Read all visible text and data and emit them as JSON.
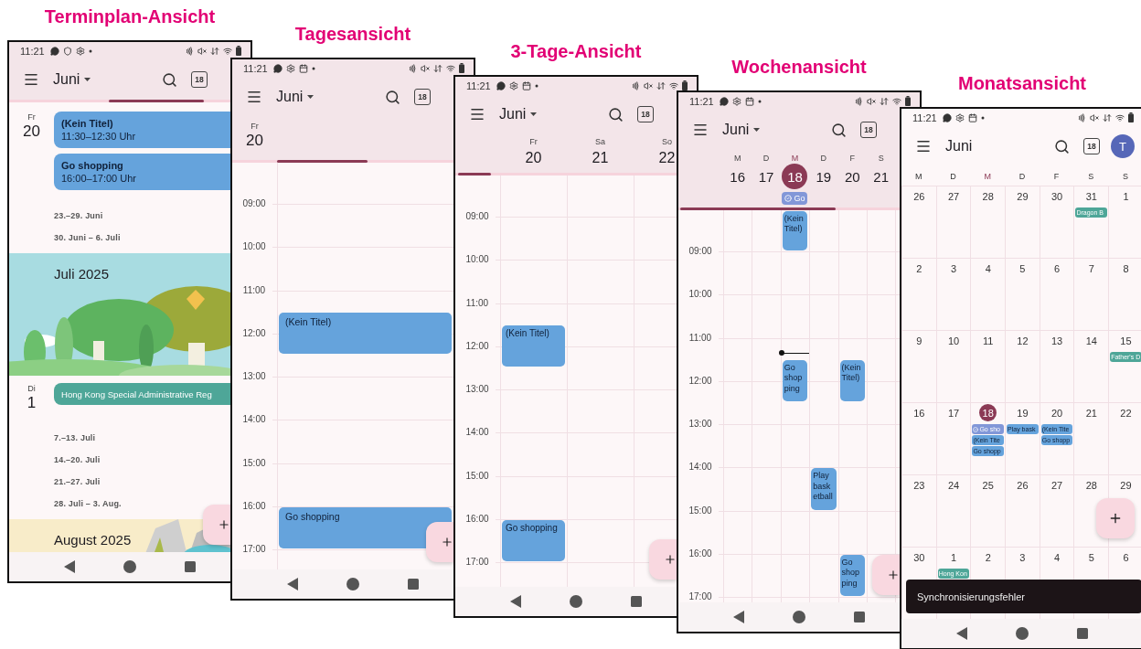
{
  "screens": [
    {
      "kind": "schedule",
      "caption": "Terminplan-Ansicht",
      "time": "11:21",
      "month": "Juni",
      "dropdown": true,
      "today": "18",
      "agenda": [
        {
          "kind": "day",
          "weekday": "Fr",
          "day": "20",
          "events": [
            {
              "title": "(Kein Titel)",
              "time": "11:30–12:30 Uhr",
              "kind": "event",
              "color": "#65a3dc"
            },
            {
              "title": "Go shopping",
              "time": "16:00–17:00 Uhr",
              "kind": "event",
              "color": "#65a3dc"
            }
          ]
        },
        {
          "kind": "range",
          "text": "23.–29. Juni"
        },
        {
          "kind": "range",
          "text": "30. Juni – 6. Juli"
        },
        {
          "kind": "month",
          "title": "Juli 2025"
        },
        {
          "kind": "day",
          "weekday": "Di",
          "day": "1",
          "events": [
            {
              "title": "Hong Kong Special Administrative Reg",
              "kind": "holiday",
              "color": "#4ea698"
            }
          ]
        },
        {
          "kind": "range",
          "text": "7.–13. Juli"
        },
        {
          "kind": "range",
          "text": "14.–20. Juli"
        },
        {
          "kind": "range",
          "text": "21.–27. Juli"
        },
        {
          "kind": "range",
          "text": "28. Juli – 3. Aug."
        },
        {
          "kind": "month",
          "title": "August 2025"
        }
      ]
    },
    {
      "kind": "day",
      "caption": "Tagesansicht",
      "time": "11:21",
      "month": "Juni",
      "dropdown": true,
      "today": "18",
      "days": [
        {
          "weekday": "Fr",
          "day": "20",
          "events": [
            {
              "title": "(Kein Titel)",
              "kind": "event",
              "color": "#65a3dc"
            },
            {
              "title": "Go shopping",
              "kind": "event",
              "color": "#65a3dc"
            }
          ]
        }
      ],
      "hours": [
        "09:00",
        "10:00",
        "11:00",
        "12:00",
        "13:00",
        "14:00",
        "15:00",
        "16:00",
        "17:00"
      ]
    },
    {
      "kind": "three",
      "caption": "3-Tage-Ansicht",
      "time": "11:21",
      "month": "Juni",
      "dropdown": true,
      "today": "18",
      "days": [
        {
          "weekday": "Fr",
          "day": "20",
          "events": [
            {
              "title": "(Kein Titel)",
              "kind": "event",
              "color": "#65a3dc"
            },
            {
              "title": "Go shopping",
              "kind": "event",
              "color": "#65a3dc"
            }
          ]
        },
        {
          "weekday": "Sa",
          "day": "21"
        },
        {
          "weekday": "So",
          "day": "22"
        }
      ],
      "hours": [
        "09:00",
        "10:00",
        "11:00",
        "12:00",
        "13:00",
        "14:00",
        "15:00",
        "16:00",
        "17:00"
      ]
    },
    {
      "kind": "week",
      "caption": "Wochenansicht",
      "time": "11:21",
      "month": "Juni",
      "dropdown": true,
      "today": "18",
      "days": [
        {
          "weekday": "M",
          "day": "16",
          "today": false,
          "now": false
        },
        {
          "weekday": "D",
          "day": "17",
          "today": false,
          "now": false
        },
        {
          "weekday": "M",
          "day": "18",
          "today": true,
          "now": true,
          "all_day": [
            {
              "title": "Go",
              "kind": "task",
              "color": "#8297d8"
            }
          ],
          "events": [
            {
              "title": "(Kein Titel)",
              "kind": "event",
              "color": "#65a3dc"
            },
            {
              "title": "Go shopping",
              "kind": "event",
              "color": "#65a3dc"
            }
          ]
        },
        {
          "weekday": "D",
          "day": "19",
          "today": false,
          "now": false,
          "events": [
            {
              "title": "Play basketball",
              "kind": "event",
              "color": "#65a3dc"
            }
          ]
        },
        {
          "weekday": "F",
          "day": "20",
          "today": false,
          "now": false,
          "events": [
            {
              "title": "(Kein Titel)",
              "kind": "event",
              "color": "#65a3dc"
            },
            {
              "title": "Go shopping",
              "kind": "event",
              "color": "#65a3dc"
            }
          ]
        },
        {
          "weekday": "S",
          "day": "21",
          "today": false,
          "now": false
        }
      ],
      "hours": [
        "09:00",
        "10:00",
        "11:00",
        "12:00",
        "13:00",
        "14:00",
        "15:00",
        "16:00",
        "17:00"
      ]
    },
    {
      "kind": "month",
      "caption": "Monatsansicht",
      "time": "11:21",
      "month": "Juni",
      "dropdown": false,
      "today": "18",
      "avatar": "T",
      "weekdays": [
        {
          "label": "M",
          "today": false
        },
        {
          "label": "D",
          "today": false
        },
        {
          "label": "M",
          "today": true
        },
        {
          "label": "D",
          "today": false
        },
        {
          "label": "F",
          "today": false
        },
        {
          "label": "S",
          "today": false
        },
        {
          "label": "S",
          "today": false
        }
      ],
      "weeks": [
        [
          {
            "day": "26",
            "today": false
          },
          {
            "day": "27",
            "today": false
          },
          {
            "day": "28",
            "today": false
          },
          {
            "day": "29",
            "today": false
          },
          {
            "day": "30",
            "today": false
          },
          {
            "day": "31",
            "today": false,
            "events": [
              {
                "title": "Dragon B",
                "kind": "holiday",
                "color": "#4ea698"
              }
            ]
          },
          {
            "day": "1",
            "today": false
          }
        ],
        [
          {
            "day": "2",
            "today": false
          },
          {
            "day": "3",
            "today": false
          },
          {
            "day": "4",
            "today": false
          },
          {
            "day": "5",
            "today": false
          },
          {
            "day": "6",
            "today": false
          },
          {
            "day": "7",
            "today": false
          },
          {
            "day": "8",
            "today": false
          }
        ],
        [
          {
            "day": "9",
            "today": false
          },
          {
            "day": "10",
            "today": false
          },
          {
            "day": "11",
            "today": false
          },
          {
            "day": "12",
            "today": false
          },
          {
            "day": "13",
            "today": false
          },
          {
            "day": "14",
            "today": false
          },
          {
            "day": "15",
            "today": false,
            "events": [
              {
                "title": "Father's D",
                "kind": "holiday",
                "color": "#4ea698"
              }
            ]
          }
        ],
        [
          {
            "day": "16",
            "today": false
          },
          {
            "day": "17",
            "today": false
          },
          {
            "day": "18",
            "today": true,
            "events": [
              {
                "title": "Go sho",
                "kind": "task",
                "color": "#8297d8"
              },
              {
                "title": "(Kein Tite",
                "kind": "event",
                "color": "#65a3dc"
              },
              {
                "title": "Go shopp",
                "kind": "event",
                "color": "#65a3dc"
              }
            ]
          },
          {
            "day": "19",
            "today": false,
            "events": [
              {
                "title": "Play bask",
                "kind": "event",
                "color": "#65a3dc"
              }
            ]
          },
          {
            "day": "20",
            "today": false,
            "events": [
              {
                "title": "(Kein Tite",
                "kind": "event",
                "color": "#65a3dc"
              },
              {
                "title": "Go shopp",
                "kind": "event",
                "color": "#65a3dc"
              }
            ]
          },
          {
            "day": "21",
            "today": false
          },
          {
            "day": "22",
            "today": false
          }
        ],
        [
          {
            "day": "23",
            "today": false
          },
          {
            "day": "24",
            "today": false
          },
          {
            "day": "25",
            "today": false
          },
          {
            "day": "26",
            "today": false
          },
          {
            "day": "27",
            "today": false
          },
          {
            "day": "28",
            "today": false
          },
          {
            "day": "29",
            "today": false
          }
        ],
        [
          {
            "day": "30",
            "today": false
          },
          {
            "day": "1",
            "today": false,
            "events": [
              {
                "title": "Hong Kon",
                "kind": "holiday",
                "color": "#4ea698"
              }
            ]
          },
          {
            "day": "2",
            "today": false
          },
          {
            "day": "3",
            "today": false
          },
          {
            "day": "4",
            "today": false
          },
          {
            "day": "5",
            "today": false
          },
          {
            "day": "6",
            "today": false
          }
        ]
      ],
      "snackbar": "Synchronisierungsfehler"
    }
  ]
}
